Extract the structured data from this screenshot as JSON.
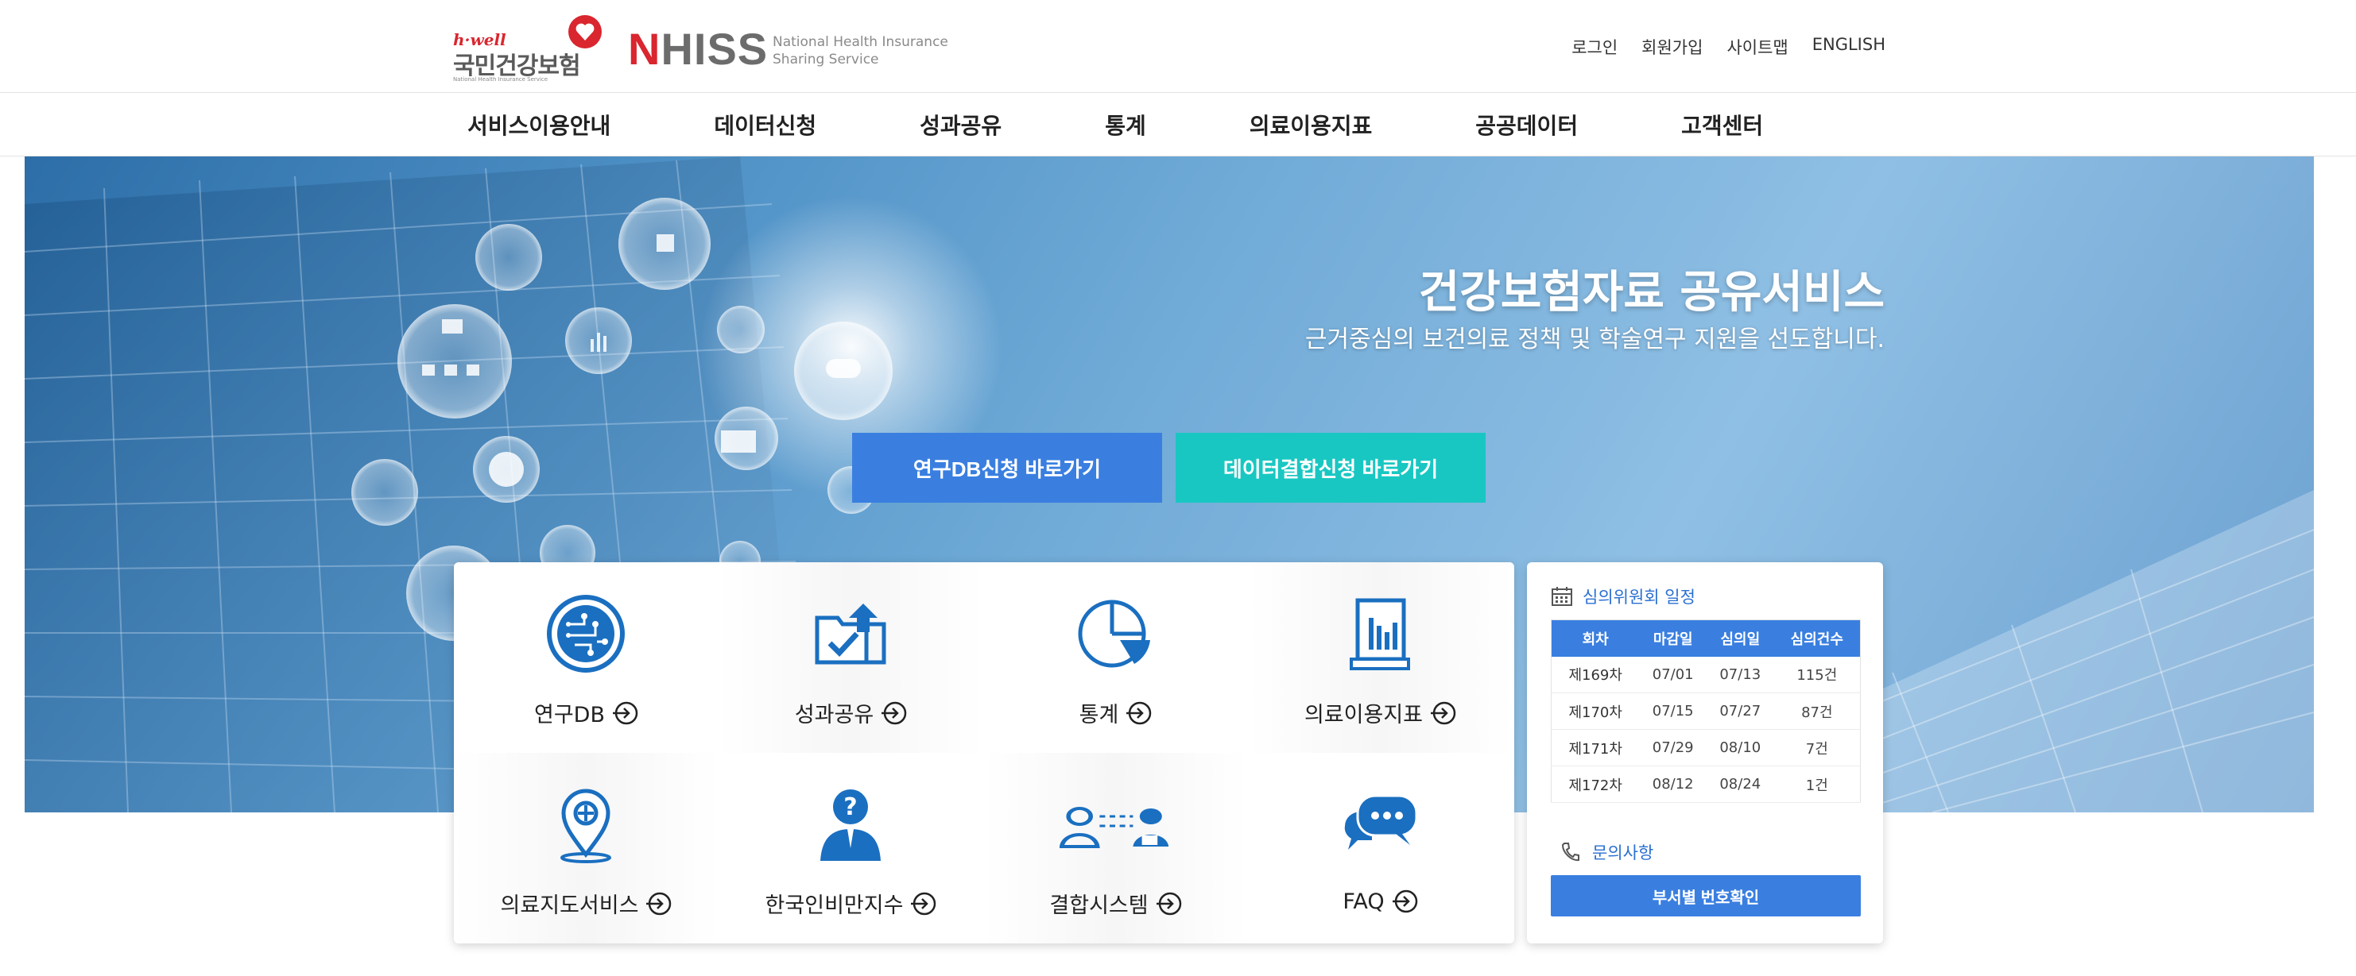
{
  "brand": {
    "hwell": "h·well",
    "org_name": "국민건강보험",
    "org_sub": "National Health Insurance Service",
    "logo_n": "N",
    "logo_rest": "HISS",
    "desc": "National Health Insurance\nSharing Service",
    "brand_red": "#d9262f"
  },
  "util_nav": [
    "로그인",
    "회원가입",
    "사이트맵",
    "ENGLISH"
  ],
  "gnb": [
    "서비스이용안내",
    "데이터신청",
    "성과공유",
    "통계",
    "의료이용지표",
    "공공데이터",
    "고객센터"
  ],
  "hero": {
    "title": "건강보험자료 공유서비스",
    "subtitle": "근거중심의 보건의료 정책 및 학술연구 지원을 선도합니다.",
    "btn_db": "연구DB신청 바로가기",
    "btn_merge": "데이터결합신청 바로가기"
  },
  "quick_menu": [
    {
      "label": "연구DB",
      "icon": "circuit-icon"
    },
    {
      "label": "성과공유",
      "icon": "folder-check-icon"
    },
    {
      "label": "통계",
      "icon": "pie-chart-icon"
    },
    {
      "label": "의료이용지표",
      "icon": "document-chart-icon"
    },
    {
      "label": "의료지도서비스",
      "icon": "map-pin-icon"
    },
    {
      "label": "한국인비만지수",
      "icon": "person-question-icon"
    },
    {
      "label": "결합시스템",
      "icon": "people-link-icon"
    },
    {
      "label": "FAQ",
      "icon": "chat-bubbles-icon"
    }
  ],
  "schedule": {
    "title": "심의위원회 일정",
    "headers": [
      "회차",
      "마감일",
      "심의일",
      "심의건수"
    ],
    "rows": [
      [
        "제169차",
        "07/01",
        "07/13",
        "115건"
      ],
      [
        "제170차",
        "07/15",
        "07/27",
        "87건"
      ],
      [
        "제171차",
        "07/29",
        "08/10",
        "7건"
      ],
      [
        "제172차",
        "08/12",
        "08/24",
        "1건"
      ]
    ]
  },
  "contact": {
    "title": "문의사항",
    "button": "부서별 번호확인"
  },
  "colors": {
    "primary_blue": "#3a7fe0",
    "teal": "#19c7c2",
    "icon_blue": "#1a6fc0"
  }
}
